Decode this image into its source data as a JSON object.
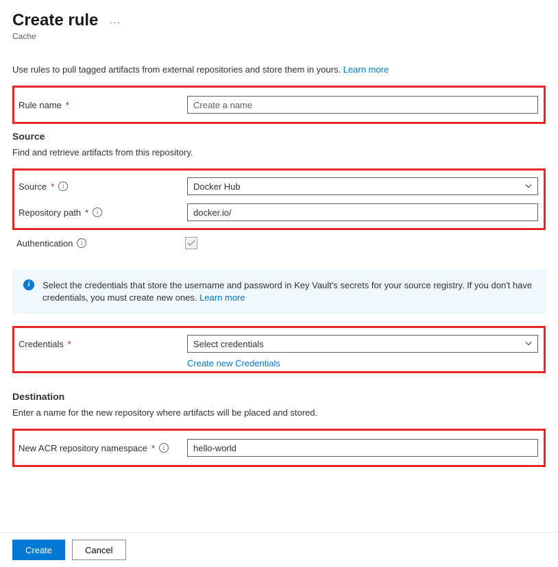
{
  "header": {
    "title": "Create rule",
    "subtitle": "Cache"
  },
  "intro": {
    "text": "Use rules to pull tagged artifacts from external repositories and store them in yours. ",
    "learnMore": "Learn more"
  },
  "fields": {
    "ruleName": {
      "label": "Rule name",
      "placeholder": "Create a name",
      "value": ""
    },
    "sourceSection": {
      "title": "Source",
      "desc": "Find and retrieve artifacts from this repository."
    },
    "source": {
      "label": "Source",
      "value": "Docker Hub"
    },
    "repoPath": {
      "label": "Repository path",
      "value": "docker.io/"
    },
    "auth": {
      "label": "Authentication"
    },
    "credentials": {
      "label": "Credentials",
      "value": "Select credentials",
      "createLink": "Create new Credentials"
    },
    "destSection": {
      "title": "Destination",
      "desc": "Enter a name for the new repository where artifacts will be placed and stored."
    },
    "namespace": {
      "label": "New ACR repository namespace",
      "value": "hello-world"
    }
  },
  "infoBanner": {
    "text": "Select the credentials that store the username and password in Key Vault's secrets for your source registry. If you don't have credentials, you must create new ones. ",
    "learnMore": "Learn more"
  },
  "footer": {
    "create": "Create",
    "cancel": "Cancel"
  }
}
